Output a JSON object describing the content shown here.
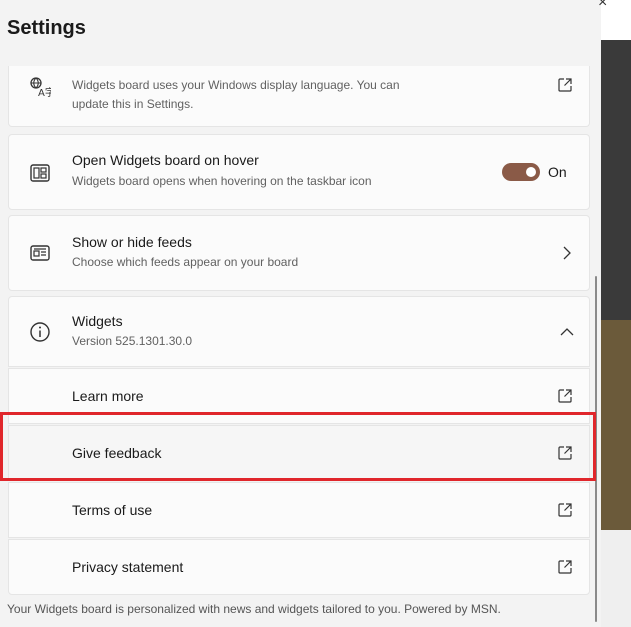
{
  "header": {
    "title": "Settings",
    "close_glyph": "×"
  },
  "language": {
    "description_line1": "Widgets board uses your Windows display language. You can",
    "description_line2": "update this in Settings."
  },
  "hover": {
    "label": "Open Widgets board on hover",
    "description": "Widgets board opens when hovering on the taskbar icon",
    "toggle_state": "On"
  },
  "feeds": {
    "label": "Show or hide feeds",
    "description": "Choose which feeds appear on your board"
  },
  "widgets": {
    "label": "Widgets",
    "version": "Version 525.1301.30.0"
  },
  "links": [
    {
      "label": "Learn more"
    },
    {
      "label": "Give feedback"
    },
    {
      "label": "Terms of use"
    },
    {
      "label": "Privacy statement"
    }
  ],
  "footer": {
    "text": "Your Widgets board is personalized with news and widgets tailored to you. Powered by MSN."
  },
  "colors": {
    "toggle_on": "#8a5a47",
    "highlight": "#e0262b"
  }
}
